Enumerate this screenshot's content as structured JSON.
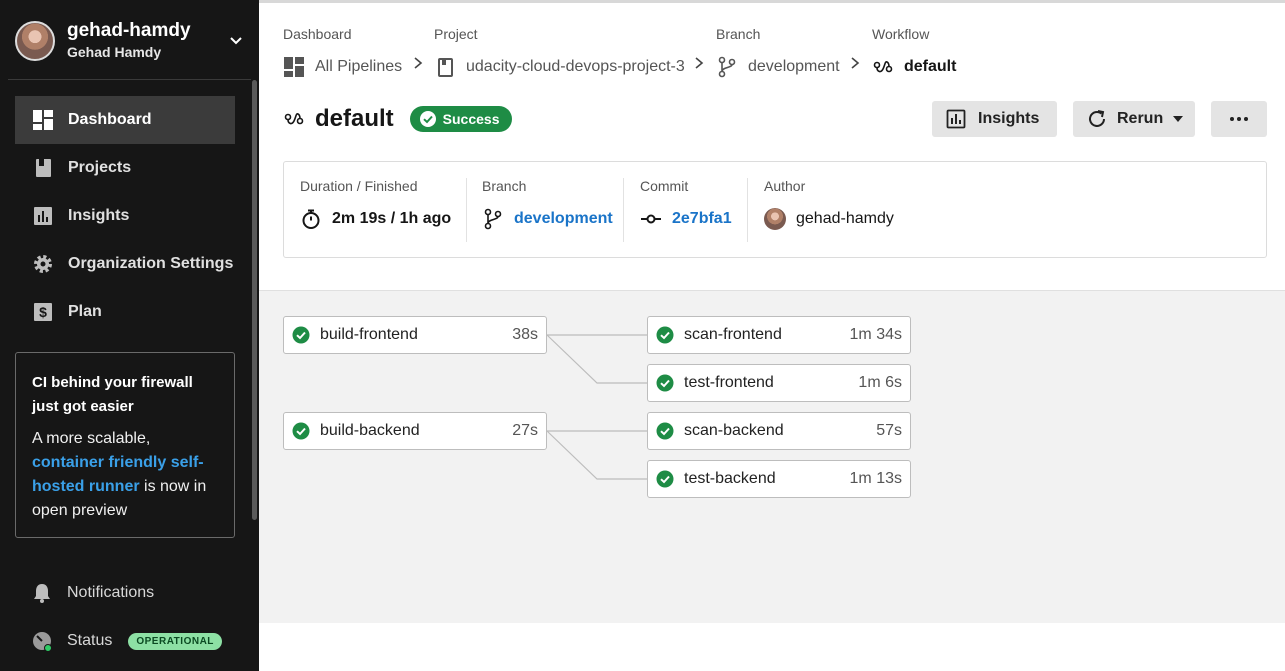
{
  "user": {
    "login": "gehad-hamdy",
    "name": "Gehad Hamdy"
  },
  "sidebar": {
    "items": [
      {
        "label": "Dashboard",
        "icon": "dashboard-icon",
        "active": true
      },
      {
        "label": "Projects",
        "icon": "projects-icon"
      },
      {
        "label": "Insights",
        "icon": "insights-icon"
      },
      {
        "label": "Organization Settings",
        "icon": "gear-icon"
      },
      {
        "label": "Plan",
        "icon": "dollar-icon"
      }
    ],
    "promo": {
      "title": "CI behind your firewall just got easier",
      "body_prefix": "A more scalable, ",
      "link": "container friendly self-hosted runner",
      "body_suffix": " is now in open preview"
    },
    "notifications": "Notifications",
    "status": {
      "label": "Status",
      "badge": "OPERATIONAL"
    }
  },
  "breadcrumbs": [
    {
      "label": "Dashboard",
      "value": "All Pipelines",
      "icon": "pipelines-icon"
    },
    {
      "label": "Project",
      "value": "udacity-cloud-devops-project-3",
      "icon": "project-icon"
    },
    {
      "label": "Branch",
      "value": "development",
      "icon": "branch-icon"
    },
    {
      "label": "Workflow",
      "value": "default",
      "icon": "workflow-icon"
    }
  ],
  "workflow": {
    "title": "default",
    "status": "Success",
    "buttons": {
      "insights": "Insights",
      "rerun": "Rerun",
      "more": "..."
    }
  },
  "summary": {
    "duration_label": "Duration / Finished",
    "duration_value": "2m 19s / 1h ago",
    "branch_label": "Branch",
    "branch_value": "development",
    "commit_label": "Commit",
    "commit_value": "2e7bfa1",
    "author_label": "Author",
    "author_value": "gehad-hamdy"
  },
  "jobs": [
    {
      "name": "build-frontend",
      "duration": "38s",
      "status": "success"
    },
    {
      "name": "scan-frontend",
      "duration": "1m 34s",
      "status": "success"
    },
    {
      "name": "test-frontend",
      "duration": "1m 6s",
      "status": "success"
    },
    {
      "name": "build-backend",
      "duration": "27s",
      "status": "success"
    },
    {
      "name": "scan-backend",
      "duration": "57s",
      "status": "success"
    },
    {
      "name": "test-backend",
      "duration": "1m 13s",
      "status": "success"
    }
  ],
  "colors": {
    "success": "#1e8c45",
    "link": "#1a74c8",
    "sidebar": "#161616"
  }
}
